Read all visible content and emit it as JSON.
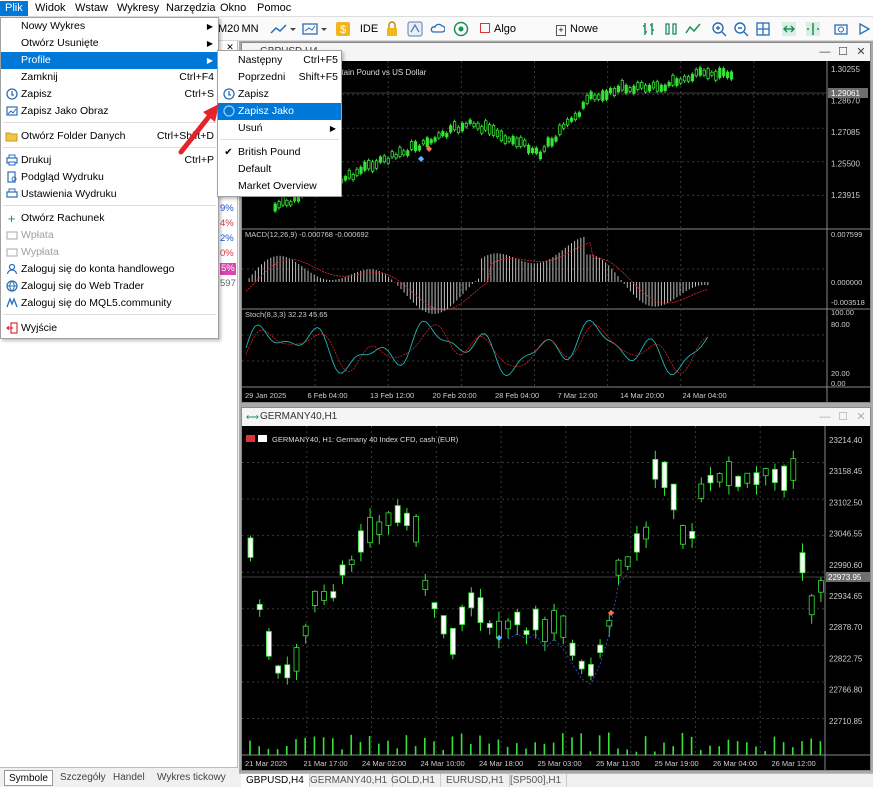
{
  "menubar": {
    "items": [
      "Plik",
      "Widok",
      "Wstaw",
      "Wykresy",
      "Narzędzia",
      "Okno",
      "Pomoc"
    ]
  },
  "toolbar": {
    "m20": "M20",
    "mn": "MN",
    "ide": "IDE",
    "algo": "Algo Trading",
    "new_order": "Nowe Zlecenie"
  },
  "file_menu": {
    "items": [
      {
        "label": "Nowy Wykres",
        "shortcut": "",
        "sub": true,
        "icon": ""
      },
      {
        "label": "Otwórz Usunięte",
        "shortcut": "",
        "sub": true,
        "icon": ""
      },
      {
        "label": "Profile",
        "shortcut": "",
        "sub": true,
        "icon": ""
      },
      {
        "label": "Zamknij",
        "shortcut": "Ctrl+F4",
        "sub": false,
        "icon": ""
      },
      {
        "label": "Zapisz",
        "shortcut": "Ctrl+S",
        "sub": false,
        "icon": "save-icon"
      },
      {
        "label": "Zapisz Jako Obraz",
        "shortcut": "",
        "sub": false,
        "icon": "image-icon"
      },
      {
        "label": "Otwórz Folder Danych",
        "shortcut": "Ctrl+Shift+D",
        "sub": false,
        "icon": "folder-icon"
      },
      {
        "label": "Drukuj",
        "shortcut": "Ctrl+P",
        "sub": false,
        "icon": "print-icon"
      },
      {
        "label": "Podgląd Wydruku",
        "shortcut": "",
        "sub": false,
        "icon": "print-preview-icon"
      },
      {
        "label": "Ustawienia Wydruku",
        "shortcut": "",
        "sub": false,
        "icon": "print-setup-icon"
      },
      {
        "label": "Otwórz Rachunek",
        "shortcut": "",
        "sub": false,
        "icon": "plus-icon"
      },
      {
        "label": "Wpłata",
        "shortcut": "",
        "sub": false,
        "icon": "deposit-icon"
      },
      {
        "label": "Wypłata",
        "shortcut": "",
        "sub": false,
        "icon": "withdraw-icon"
      },
      {
        "label": "Zaloguj się do konta handlowego",
        "shortcut": "",
        "sub": false,
        "icon": "user-icon"
      },
      {
        "label": "Zaloguj się do Web Trader",
        "shortcut": "",
        "sub": false,
        "icon": "globe-icon"
      },
      {
        "label": "Zaloguj się do MQL5.community",
        "shortcut": "",
        "sub": false,
        "icon": "mql5-icon"
      },
      {
        "label": "Wyjście",
        "shortcut": "",
        "sub": false,
        "icon": "exit-icon"
      }
    ]
  },
  "profile_menu": {
    "items": [
      {
        "label": "Następny",
        "shortcut": "Ctrl+F5"
      },
      {
        "label": "Poprzedni",
        "shortcut": "Shift+F5"
      },
      {
        "label": "Zapisz",
        "shortcut": ""
      },
      {
        "label": "Zapisz Jako",
        "shortcut": ""
      },
      {
        "label": "Usuń",
        "shortcut": ""
      },
      {
        "label": "British Pound",
        "shortcut": ""
      },
      {
        "label": "Default",
        "shortcut": ""
      },
      {
        "label": "Market Overview",
        "shortcut": ""
      }
    ]
  },
  "left_panel": {
    "pcts": [
      "9%",
      "4%",
      "2%",
      "0%",
      "5%",
      "597"
    ],
    "tabs": [
      "Symbole",
      "Szczegóły",
      "Handel",
      "Wykres tickowy"
    ]
  },
  "chart1": {
    "title": "GBPUSD,H4",
    "info": "ritain Pound vs US Dollar",
    "price_ticks": [
      "1.30255",
      "1.28670",
      "1.27085",
      "1.25500",
      "1.23915"
    ],
    "current_price": "1.29061",
    "macd_label": "MACD(12,26,9) -0.000768 -0.000692",
    "macd_ticks": [
      "0.007599",
      "0.000000",
      "-0.003518"
    ],
    "stoch_label": "Stoch(8,3,3) 32.23 45.65",
    "stoch_ticks": [
      "100.00",
      "80.00",
      "20.00",
      "0.00"
    ],
    "time_ticks": [
      "29 Jan 2025",
      "6 Feb 04:00",
      "13 Feb 12:00",
      "20 Feb 20:00",
      "28 Feb 04:00",
      "7 Mar 12:00",
      "14 Mar 20:00",
      "24 Mar 04:00"
    ]
  },
  "chart2": {
    "title": "GERMANY40,H1",
    "info": "GERMANY40, H1:  Germany 40 Index CFD, cash (EUR)",
    "price_ticks": [
      "23214.40",
      "23158.45",
      "23102.50",
      "23046.55",
      "22990.60",
      "22934.65",
      "22878.70",
      "22822.75",
      "22766.80",
      "22710.85"
    ],
    "current_price": "22973.95",
    "time_ticks": [
      "21 Mar 2025",
      "21 Mar 17:00",
      "24 Mar 02:00",
      "24 Mar 10:00",
      "24 Mar 18:00",
      "25 Mar 03:00",
      "25 Mar 11:00",
      "25 Mar 19:00",
      "26 Mar 04:00",
      "26 Mar 12:00"
    ]
  },
  "bottom_tabs": [
    "GBPUSD,H4",
    "GERMANY40,H1",
    "GOLD,H1",
    "EURUSD,H1",
    "[SP500],H1"
  ]
}
